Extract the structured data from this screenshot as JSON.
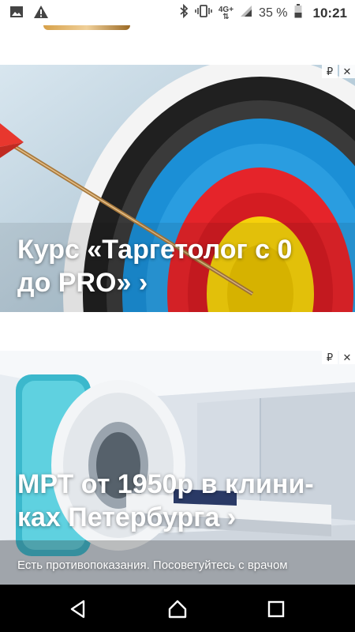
{
  "status_bar": {
    "time": "10:21",
    "battery_percent": "35 %",
    "network_type": "4G+",
    "icons": [
      "image-icon",
      "warning-icon",
      "bluetooth-icon",
      "vibrate-icon",
      "signal-icon",
      "battery-icon"
    ]
  },
  "ads": [
    {
      "title": "Курс «Таргетолог с 0 до PRO» ›",
      "badge_symbol": "₽",
      "close_symbol": "✕"
    },
    {
      "title": "МРТ от 1950р в клини-ках Петербурга ›",
      "disclaimer": "Есть противопоказания. Посоветуйтесь с врачом",
      "badge_symbol": "₽",
      "close_symbol": "✕"
    }
  ],
  "nav_bar": {
    "buttons": [
      "back-icon",
      "home-icon",
      "recents-icon"
    ]
  },
  "colors": {
    "target_blue": "#1b8fd6",
    "target_red": "#e5242a",
    "target_yellow": "#f6d10b",
    "nav_background": "#000000"
  }
}
